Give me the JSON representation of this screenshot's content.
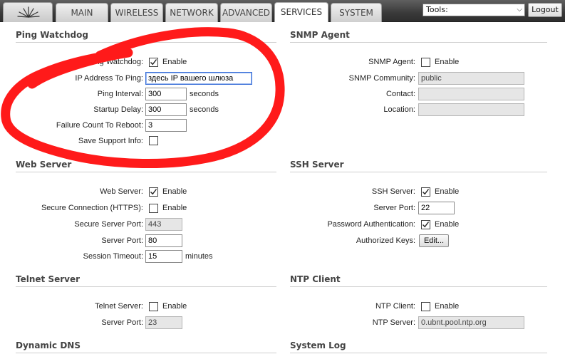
{
  "header": {
    "logo_icon": "ubiquiti-logo-icon",
    "tabs": [
      {
        "label": "MAIN"
      },
      {
        "label": "WIRELESS"
      },
      {
        "label": "NETWORK"
      },
      {
        "label": "ADVANCED"
      },
      {
        "label": "SERVICES",
        "active": true
      },
      {
        "label": "SYSTEM"
      }
    ],
    "tools_select": "Tools:",
    "logout_label": "Logout"
  },
  "ping_watchdog": {
    "title": "Ping Watchdog",
    "enable_label": "Ping Watchdog:",
    "enable_text": "Enable",
    "enabled": true,
    "ip_label": "IP Address To Ping:",
    "ip_value": "здесь IP вашего шлюза",
    "interval_label": "Ping Interval:",
    "interval_value": "300",
    "interval_unit": "seconds",
    "startup_label": "Startup Delay:",
    "startup_value": "300",
    "startup_unit": "seconds",
    "failure_label": "Failure Count To Reboot:",
    "failure_value": "3",
    "support_label": "Save Support Info:",
    "support_checked": false
  },
  "snmp_agent": {
    "title": "SNMP Agent",
    "agent_label": "SNMP Agent:",
    "agent_text": "Enable",
    "agent_checked": false,
    "community_label": "SNMP Community:",
    "community_value": "public",
    "contact_label": "Contact:",
    "contact_value": "",
    "location_label": "Location:",
    "location_value": ""
  },
  "web_server": {
    "title": "Web Server",
    "server_label": "Web Server:",
    "server_text": "Enable",
    "server_checked": true,
    "https_label": "Secure Connection (HTTPS):",
    "https_text": "Enable",
    "https_checked": false,
    "secure_port_label": "Secure Server Port:",
    "secure_port_value": "443",
    "port_label": "Server Port:",
    "port_value": "80",
    "timeout_label": "Session Timeout:",
    "timeout_value": "15",
    "timeout_unit": "minutes"
  },
  "ssh_server": {
    "title": "SSH Server",
    "server_label": "SSH Server:",
    "server_text": "Enable",
    "server_checked": true,
    "port_label": "Server Port:",
    "port_value": "22",
    "password_label": "Password Authentication:",
    "password_text": "Enable",
    "password_checked": true,
    "keys_label": "Authorized Keys:",
    "keys_button": "Edit..."
  },
  "telnet_server": {
    "title": "Telnet Server",
    "server_label": "Telnet Server:",
    "server_text": "Enable",
    "server_checked": false,
    "port_label": "Server Port:",
    "port_value": "23"
  },
  "ntp_client": {
    "title": "NTP Client",
    "client_label": "NTP Client:",
    "client_text": "Enable",
    "client_checked": false,
    "server_label": "NTP Server:",
    "server_value": "0.ubnt.pool.ntp.org"
  },
  "dynamic_dns": {
    "title": "Dynamic DNS"
  },
  "system_log": {
    "title": "System Log"
  },
  "annotation": {
    "color": "#ff1a1a"
  }
}
